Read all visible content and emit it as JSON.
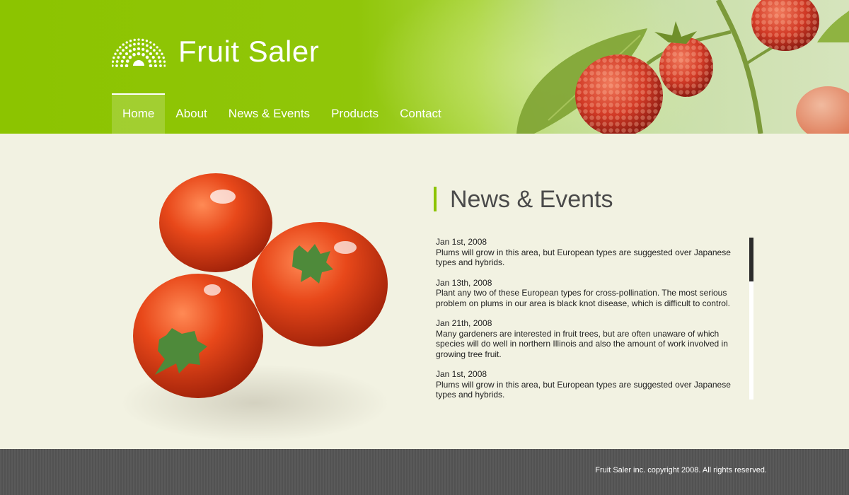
{
  "brand": {
    "name": "Fruit Saler",
    "logo_icon": "sunburst-logo-icon"
  },
  "nav": {
    "items": [
      {
        "label": "Home",
        "active": true
      },
      {
        "label": "About",
        "active": false
      },
      {
        "label": "News & Events",
        "active": false
      },
      {
        "label": "Products",
        "active": false
      },
      {
        "label": "Contact",
        "active": false
      }
    ]
  },
  "news": {
    "title": "News & Events",
    "items": [
      {
        "date": "Jan 1st, 2008",
        "text": "Plums will grow in this area, but European types are suggested over Japanese types and hybrids."
      },
      {
        "date": "Jan 13th, 2008",
        "text": "Plant any two of these European types for cross-pollination. The most serious problem on plums in our area is black knot disease, which is difficult to control."
      },
      {
        "date": "Jan 21th, 2008",
        "text": "Many gardeners are interested in fruit trees, but are often unaware of which species will do well in northern Illinois and also the amount of work involved in growing tree fruit."
      },
      {
        "date": "Jan 1st, 2008",
        "text": "Plums will grow in this area, but European types are suggested over Japanese types and hybrids."
      }
    ]
  },
  "footer": {
    "copyright": "Fruit Saler inc. copyright 2008. All rights reserved."
  },
  "colors": {
    "accent": "#8cc400",
    "background": "#f2f2e2",
    "footer": "#555555"
  }
}
